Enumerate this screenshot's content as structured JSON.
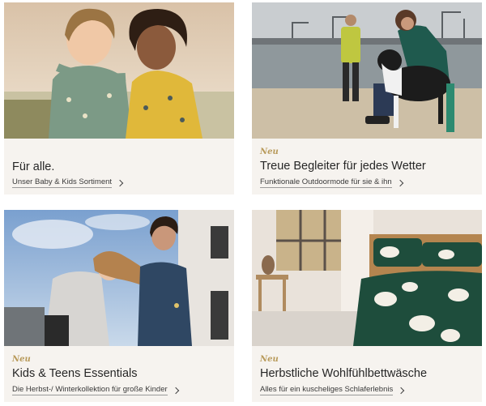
{
  "cards": [
    {
      "badge": "",
      "title": "Für alle.",
      "link": "Unser Baby & Kids Sortiment",
      "image": "two-children-in-rain-jackets",
      "chevron_icon": "chevron-right-icon"
    },
    {
      "badge": "Neu",
      "title": "Treue Begleiter für jedes Wetter",
      "link": "Funktionale Outdoormode für sie & ihn",
      "image": "couple-with-dog-at-harbor-beach",
      "chevron_icon": "chevron-right-icon"
    },
    {
      "badge": "Neu",
      "title": "Kids & Teens Essentials",
      "link": "Die Herbst-/ Winterkollektion für große Kinder",
      "image": "two-teens-outdoors",
      "chevron_icon": "chevron-right-icon"
    },
    {
      "badge": "Neu",
      "title": "Herbstliche Wohlfühlbettwäsche",
      "link": "Alles für ein kuscheliges Schlaferlebnis",
      "image": "bedroom-with-green-floral-bedding",
      "chevron_icon": "chevron-right-icon"
    }
  ],
  "colors": {
    "card_bg": "#f6f3ef",
    "badge": "#b89a5a",
    "text": "#262626"
  }
}
